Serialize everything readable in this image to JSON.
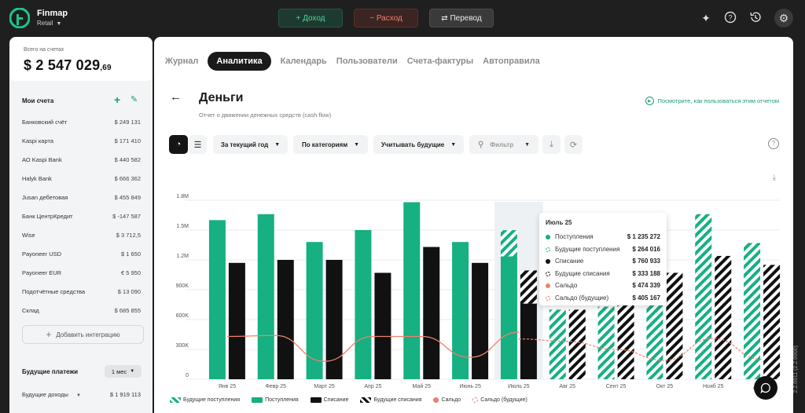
{
  "brand": {
    "name": "Finmap",
    "sub": "Retail"
  },
  "topbar": {
    "income": "+ Доход",
    "expense": "− Расход",
    "transfer": "⇄ Перевод"
  },
  "sidebar": {
    "total_label": "Всего на счетах",
    "total_main": "$ 2 547 029",
    "total_cents": ",69",
    "accounts_title": "Мои счета",
    "accounts": [
      {
        "name": "Банковский счёт",
        "amount": "$ 249 131"
      },
      {
        "name": "Kaspi карта",
        "amount": "$ 171 410"
      },
      {
        "name": "АО Kaspi Bank",
        "amount": "$ 440 582"
      },
      {
        "name": "Halyk Bank",
        "amount": "$ 666 362"
      },
      {
        "name": "Jusan дебетовая",
        "amount": "$ 455 849"
      },
      {
        "name": "Банк ЦентрКредит",
        "amount": "$ -147 587"
      },
      {
        "name": "Wise",
        "amount": "$ 3 712,5"
      },
      {
        "name": "Payoneer USD",
        "amount": "$ 1 650"
      },
      {
        "name": "Payoneer EUR",
        "amount": "€ 5 950"
      },
      {
        "name": "Подотчётные средства",
        "amount": "$ 13 090"
      },
      {
        "name": "Склад",
        "amount": "$ 685 855"
      }
    ],
    "add_integration": "Добавить интеграцию",
    "future_title": "Будущие платежи",
    "period": "1 мес",
    "future_income_label": "Будущие доходы",
    "future_income_amount": "$ 1 919 113"
  },
  "tabs": [
    "Журнал",
    "Аналитика",
    "Календарь",
    "Пользователи",
    "Счета-фактуры",
    "Автоправила"
  ],
  "page": {
    "title": "Деньги",
    "subtitle": "Отчет о движении денежных средств (cash flow)",
    "howto": "Посмотрите, как пользоваться этим отчетом"
  },
  "toolbar": {
    "period": "За текущий год",
    "group": "По категориям",
    "future": "Учитывать будущие",
    "filter": "Фильтр"
  },
  "colors": {
    "income": "#16b082",
    "expense": "#111111",
    "balance": "#f0806d",
    "accent": "#1aa06a"
  },
  "chart_data": {
    "type": "bar",
    "categories": [
      "Янв 25",
      "Февр 25",
      "Март 25",
      "Апр 25",
      "Май 25",
      "Июнь 25",
      "Июль 25",
      "Авг 25",
      "Сент 25",
      "Окт 25",
      "Нояб 25",
      "Дек 25"
    ],
    "y_ticks": [
      "0",
      "300K",
      "600K",
      "900K",
      "1.2M",
      "1.5M",
      "1.8M"
    ],
    "ylim": [
      0,
      1800000
    ],
    "series": [
      {
        "name": "Поступления",
        "values": [
          1600000,
          1660000,
          1380000,
          1500000,
          1780000,
          1380000,
          1235272,
          0,
          0,
          0,
          0,
          0
        ]
      },
      {
        "name": "Будущие поступления",
        "values": [
          0,
          0,
          0,
          0,
          0,
          0,
          264016,
          700000,
          730000,
          920000,
          1660000,
          1370000
        ]
      },
      {
        "name": "Списание",
        "values": [
          1170000,
          1200000,
          1200000,
          1070000,
          1330000,
          1170000,
          760933,
          0,
          0,
          0,
          0,
          0
        ]
      },
      {
        "name": "Будущие списания",
        "values": [
          0,
          0,
          0,
          0,
          0,
          0,
          333188,
          700000,
          860000,
          1070000,
          1240000,
          1150000
        ]
      },
      {
        "name": "Сальдо",
        "values": [
          430000,
          440000,
          180000,
          430000,
          430000,
          220000,
          474339,
          0,
          0,
          0,
          0,
          0
        ]
      },
      {
        "name": "Сальдо (будущие)",
        "values": [
          0,
          0,
          0,
          0,
          0,
          0,
          405167,
          380000,
          300000,
          190000,
          410000,
          200000
        ]
      }
    ],
    "tooltip": {
      "title": "Июль 25",
      "rows": [
        {
          "label": "Поступления",
          "value": "$ 1 235 272"
        },
        {
          "label": "Будущие поступления",
          "value": "$ 264 016"
        },
        {
          "label": "Списание",
          "value": "$ 760 933"
        },
        {
          "label": "Будущие списания",
          "value": "$ 333 188"
        },
        {
          "label": "Сальдо",
          "value": "$ 474 339"
        },
        {
          "label": "Сальдо (будущие)",
          "value": "$ 405 167"
        }
      ]
    },
    "legend": [
      "Будущие поступления",
      "Поступления",
      "Списание",
      "Будущие списания",
      "Сальдо",
      "Сальдо (будущие)"
    ]
  },
  "version": "2.2.6911 (2.2.6900)"
}
